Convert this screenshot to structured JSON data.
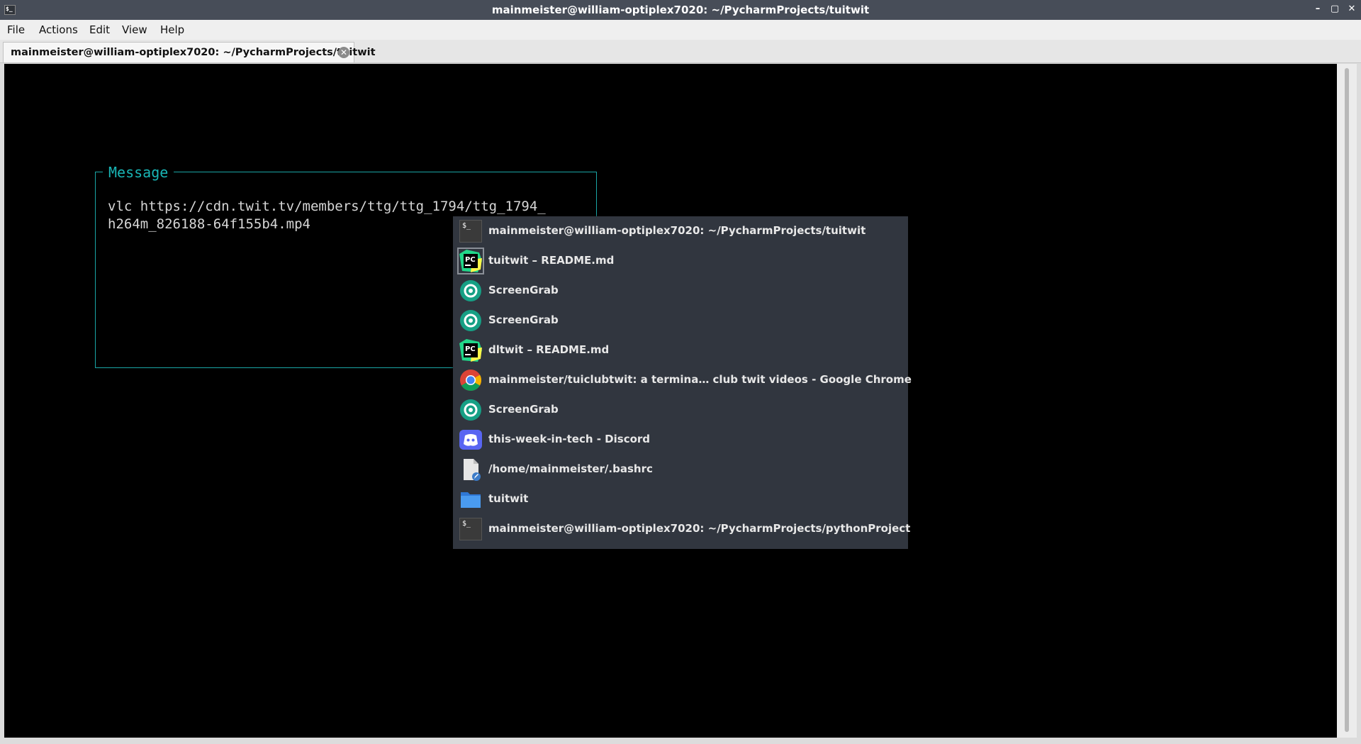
{
  "window": {
    "title": "mainmeister@william-optiplex7020: ~/PycharmProjects/tuitwit",
    "buttons": [
      "–",
      "▢",
      "✕"
    ]
  },
  "menu": [
    "File",
    "Actions",
    "Edit",
    "View",
    "Help"
  ],
  "tab": {
    "label": "mainmeister@william-optiplex7020: ~/PycharmProjects/tuitwit"
  },
  "message_box": {
    "legend": "Message",
    "line1": "vlc https://cdn.twit.tv/members/ttg/ttg_1794/ttg_1794_",
    "line2": "h264m_826188-64f155b4.mp4"
  },
  "switcher": {
    "items": [
      {
        "label": "mainmeister@william-optiplex7020: ~/PycharmProjects/tuitwit",
        "icon": "terminal-icon"
      },
      {
        "label": "tuitwit – README.md",
        "icon": "pycharm-icon"
      },
      {
        "label": "ScreenGrab",
        "icon": "screengrab-icon"
      },
      {
        "label": "ScreenGrab",
        "icon": "screengrab-icon"
      },
      {
        "label": "dltwit – README.md",
        "icon": "pycharm-icon"
      },
      {
        "label": "mainmeister/tuiclubtwit: a termina… club twit videos - Google Chrome",
        "icon": "chrome-icon"
      },
      {
        "label": "ScreenGrab",
        "icon": "screengrab-icon"
      },
      {
        "label": "this-week-in-tech - Discord",
        "icon": "discord-icon"
      },
      {
        "label": "/home/mainmeister/.bashrc",
        "icon": "text-file-icon"
      },
      {
        "label": "tuitwit",
        "icon": "folder-icon"
      },
      {
        "label": "mainmeister@william-optiplex7020: ~/PycharmProjects/pythonProject",
        "icon": "terminal-icon"
      }
    ]
  },
  "colors": {
    "terminal_bg": "#000000",
    "accent_cyan": "#19b5b5",
    "switcher_bg": "#31363f",
    "titlebar_bg": "#474d58"
  }
}
